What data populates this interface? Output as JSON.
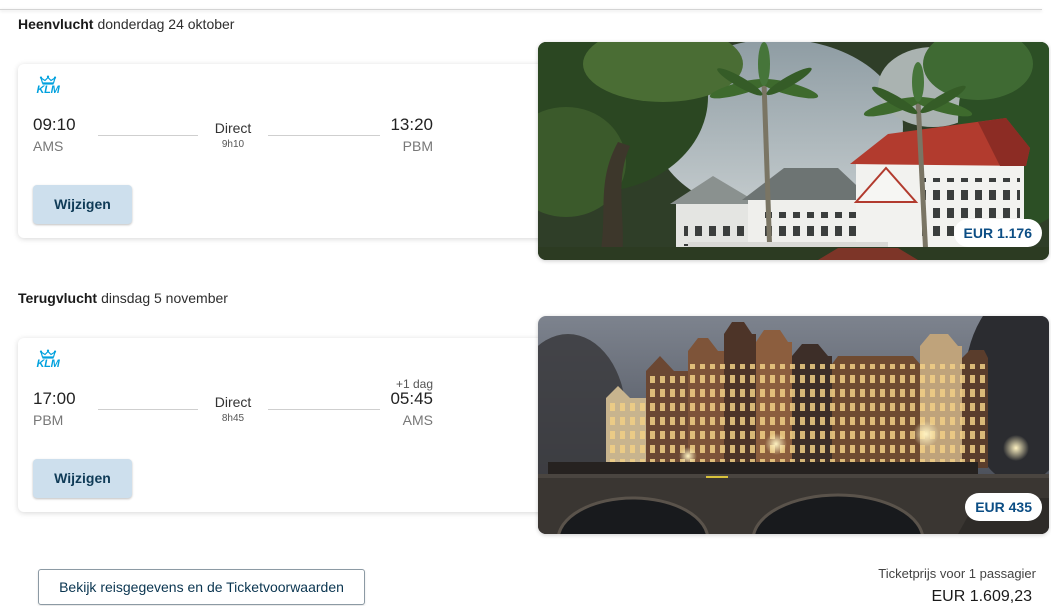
{
  "outbound": {
    "section_label": "Heenvlucht",
    "date": "donderdag 24 oktober",
    "airline": "KLM",
    "departure_time": "09:10",
    "departure_airport": "AMS",
    "stops": "Direct",
    "duration": "9h10",
    "arrival_time": "13:20",
    "arrival_airport": "PBM",
    "change_button": "Wijzigen",
    "price": "EUR 1.176"
  },
  "return": {
    "section_label": "Terugvlucht",
    "date": "dinsdag 5 november",
    "airline": "KLM",
    "departure_time": "17:00",
    "departure_airport": "PBM",
    "stops": "Direct",
    "duration": "8h45",
    "day_offset": "+1 dag",
    "arrival_time": "05:45",
    "arrival_airport": "AMS",
    "change_button": "Wijzigen",
    "price": "EUR 435"
  },
  "footer": {
    "details_button": "Bekijk reisgegevens en de Ticketvoorwaarden",
    "price_label": "Ticketprijs voor 1 passagier",
    "total_price": "EUR 1.609,23"
  },
  "icons": {
    "airline_logo": "klm-crown-icon"
  },
  "colors": {
    "brand_blue": "#00a1de",
    "button_bg": "#cddfed",
    "button_text": "#0f3b57",
    "price_text": "#0b4d84"
  }
}
